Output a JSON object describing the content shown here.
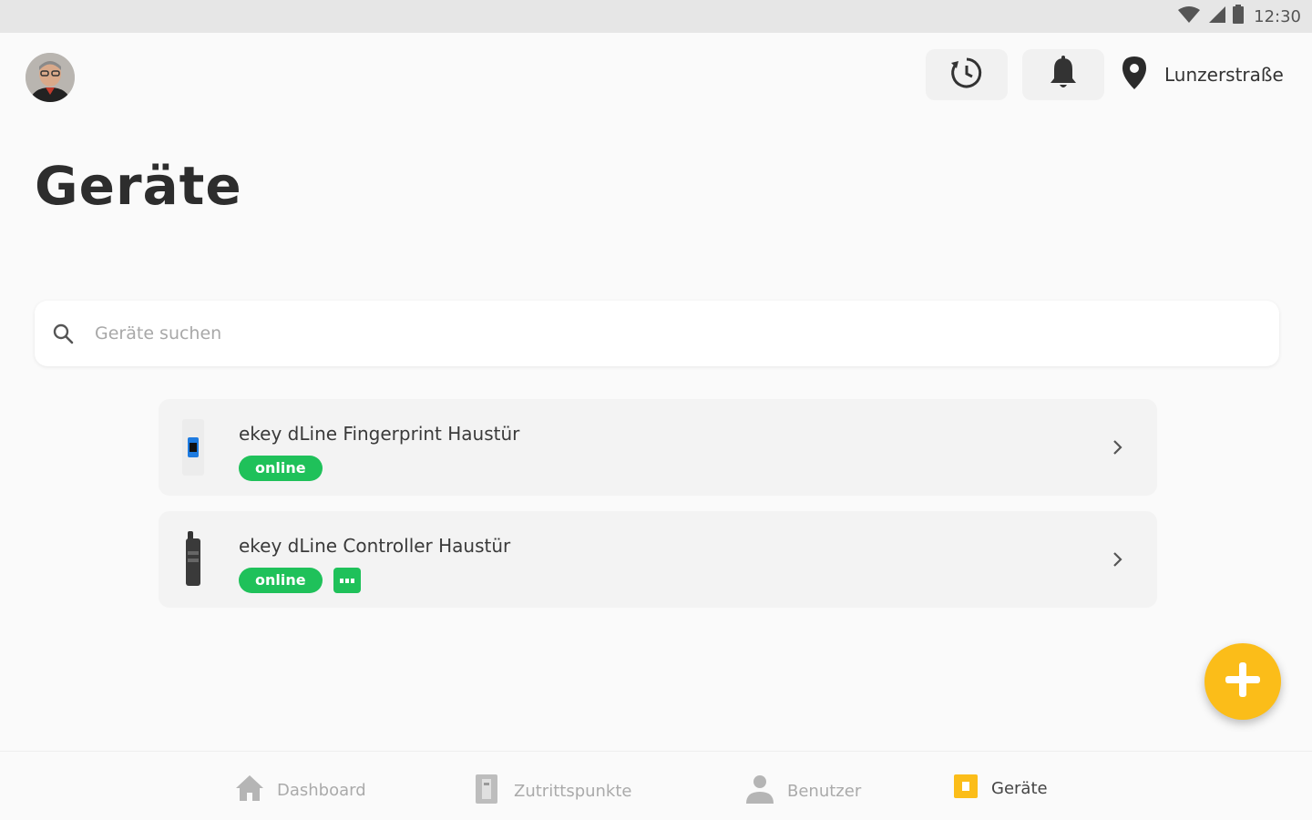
{
  "status_bar": {
    "time": "12:30",
    "icons": [
      "wifi-icon",
      "signal-icon",
      "battery-icon"
    ]
  },
  "header": {
    "avatar": "avatar",
    "history_icon": "history-icon",
    "bell_icon": "bell-icon",
    "location": {
      "icon": "location-pin-icon",
      "label": "Lunzerstraße"
    }
  },
  "page": {
    "title": "Geräte"
  },
  "search": {
    "placeholder": "Geräte suchen",
    "value": ""
  },
  "devices": [
    {
      "name": "ekey dLine Fingerprint Haustür",
      "status": "online",
      "icon": "fingerprint-reader-icon",
      "has_module": false
    },
    {
      "name": "ekey dLine Controller Haustür",
      "status": "online",
      "icon": "controller-icon",
      "has_module": true,
      "module_icon": "module-icon"
    }
  ],
  "fab": {
    "icon": "plus-icon"
  },
  "bottom_nav": {
    "items": [
      {
        "label": "Dashboard",
        "icon": "home-icon",
        "active": false
      },
      {
        "label": "Zutrittspunkte",
        "icon": "door-icon",
        "active": false
      },
      {
        "label": "Benutzer",
        "icon": "user-icon",
        "active": false
      },
      {
        "label": "Geräte",
        "icon": "device-icon",
        "active": true
      }
    ]
  },
  "colors": {
    "accent": "#fbbd19",
    "online": "#1fc15a",
    "background": "#fafafa",
    "card": "#f3f3f3"
  }
}
